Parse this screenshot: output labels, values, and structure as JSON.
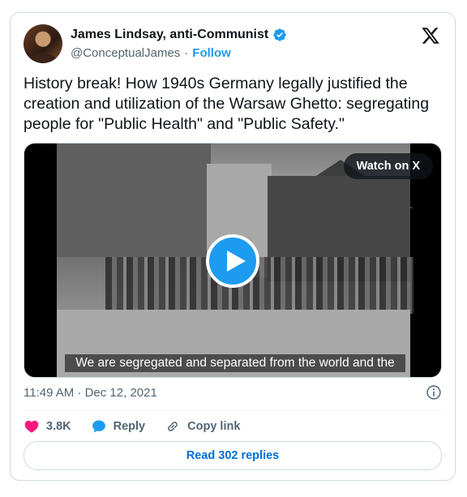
{
  "author": {
    "name": "James Lindsay, anti-Communist",
    "handle": "@ConceptualJames",
    "separator": "·",
    "follow_label": "Follow"
  },
  "tweet": {
    "text": "History break! How 1940s Germany legally justified the creation and utilization of the Warsaw Ghetto: segregating people for \"Public Health\" and \"Public Safety.\"",
    "timestamp": "11:49 AM · Dec 12, 2021"
  },
  "media": {
    "watch_label": "Watch on X",
    "subtitle": "We are segregated and separated from the world and the"
  },
  "actions": {
    "likes": "3.8K",
    "reply_label": "Reply",
    "copy_link_label": "Copy link"
  },
  "replies_button": "Read 302 replies",
  "colors": {
    "accent": "#1d9bf0",
    "like": "#f91880",
    "link": "#006fd6",
    "muted": "#536471"
  }
}
